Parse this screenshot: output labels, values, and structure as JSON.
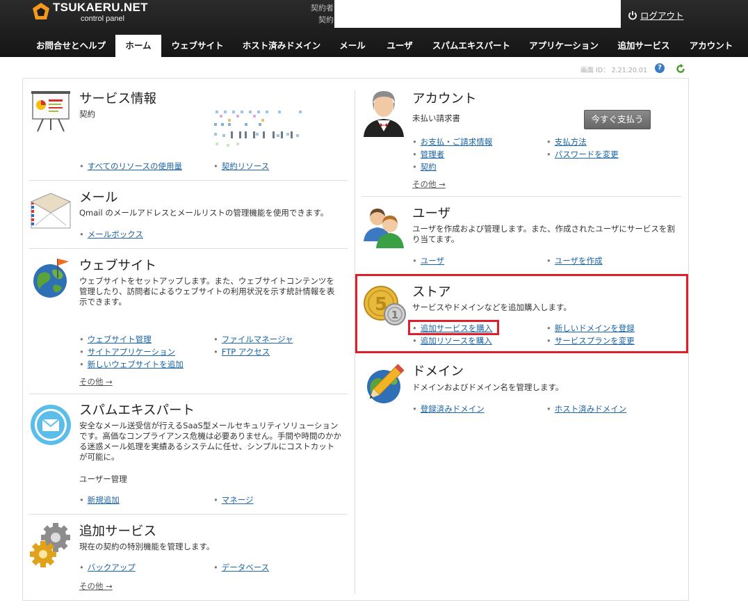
{
  "header": {
    "logo_text": "TSUKAERU.NET",
    "logo_sub": "control panel",
    "contractor_label": "契約者",
    "contract_label": "契約",
    "logout_label": "ログアウト"
  },
  "nav": {
    "tabs": [
      {
        "label": "お問合せとヘルプ"
      },
      {
        "label": "ホーム",
        "active": true
      },
      {
        "label": "ウェブサイト"
      },
      {
        "label": "ホスト済みドメイン"
      },
      {
        "label": "メール"
      },
      {
        "label": "ユーザ"
      },
      {
        "label": "スパムエキスパート"
      },
      {
        "label": "アプリケーション"
      },
      {
        "label": "追加サービス"
      },
      {
        "label": "アカウント"
      }
    ]
  },
  "screen_id": "画面 ID：  2.21.20.01",
  "sections": {
    "service_info": {
      "title": "サービス情報",
      "contract_label": "契約",
      "links": [
        "すべてのリソースの使用量",
        "契約リソース"
      ]
    },
    "mail": {
      "title": "メール",
      "desc": "Qmail のメールアドレスとメールリストの管理機能を使用できます。",
      "links": [
        "メールボックス"
      ]
    },
    "website": {
      "title": "ウェブサイト",
      "desc": "ウェブサイトをセットアップします。また、ウェブサイトコンテンツを管理したり、訪問者によるウェブサイトの利用状況を示す統計情報を表示できます。",
      "links": [
        "ウェブサイト管理",
        "ファイルマネージャ",
        "サイトアプリケーション",
        "FTP アクセス",
        "新しいウェブサイトを追加"
      ],
      "more": "その他 →"
    },
    "spam": {
      "title": "スパムエキスパート",
      "desc": "安全なメール送受信が行えるSaaS型メールセキュリティソリューションです。高価なコンプライアンス危機は必要ありません。手間や時間のかかる迷惑メール処理を実績あるシステムに任せ、シンプルにコストカットが可能に。",
      "sub_label": "ユーザー管理",
      "links": [
        "新規追加",
        "マネージ"
      ]
    },
    "addon": {
      "title": "追加サービス",
      "desc": "現在の契約の特別機能を管理します。",
      "links": [
        "バックアップ",
        "データベース"
      ],
      "more": "その他 →"
    },
    "account": {
      "title": "アカウント",
      "unpaid_label": "未払い請求書",
      "pay_button": "今すぐ支払う",
      "links": [
        "お支払・ご請求情報",
        "支払方法",
        "管理者",
        "パスワードを変更",
        "契約"
      ],
      "more": "その他 →"
    },
    "users": {
      "title": "ユーザ",
      "desc": "ユーザを作成および管理します。また、作成されたユーザにサービスを割り当てます。",
      "links": [
        "ユーザ",
        "ユーザを作成"
      ]
    },
    "store": {
      "title": "ストア",
      "desc": "サービスやドメインなどを追加購入します。",
      "links": [
        "追加サービスを購入",
        "新しいドメインを登録",
        "追加リソースを購入",
        "サービスプランを変更"
      ]
    },
    "domain": {
      "title": "ドメイン",
      "desc": "ドメインおよびドメイン名を管理します。",
      "links": [
        "登録済みドメイン",
        "ホスト済みドメイン"
      ]
    }
  },
  "colors": {
    "header_bg": "#1c1c1c",
    "link": "#1a63a5",
    "highlight": "#e01e2b",
    "accent_orange": "#f39a1e"
  },
  "icons": [
    "logo-icon",
    "power-icon",
    "help-icon",
    "refresh-icon",
    "presentation-board-icon",
    "envelope-icon",
    "globe-flag-icon",
    "spam-shield-icon",
    "gears-icon",
    "account-person-icon",
    "users-icon",
    "coins-icon",
    "globe-pencil-icon"
  ]
}
